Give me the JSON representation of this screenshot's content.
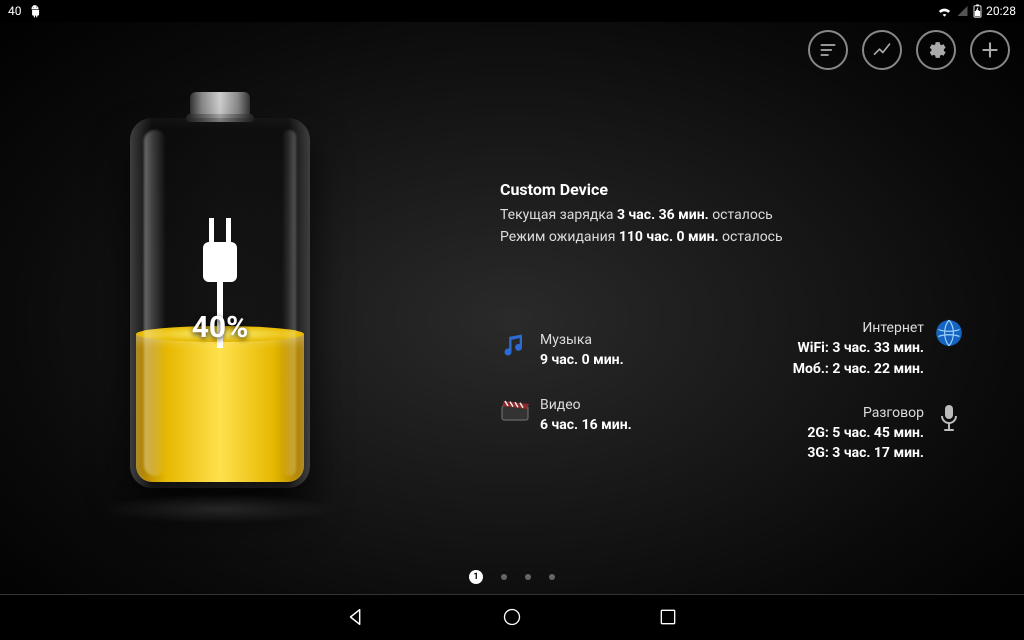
{
  "status": {
    "left_value": "40",
    "time": "20:28"
  },
  "battery": {
    "percent_label": "40%",
    "fill_percent": 40
  },
  "info": {
    "device": "Custom Device",
    "charge_prefix": "Текущая зарядка ",
    "charge_value": "3 час. 36 мин.",
    "charge_suffix": " осталось",
    "standby_prefix": "Режим ожидания ",
    "standby_value": "110 час. 0 мин.",
    "standby_suffix": " осталось"
  },
  "usage": {
    "music": {
      "title": "Музыка",
      "value": "9 час. 0 мин."
    },
    "video": {
      "title": "Видео",
      "value": "6 час. 16 мин."
    },
    "internet": {
      "title": "Интернет",
      "wifi": "WiFi: 3 час. 33 мин.",
      "mob": "Моб.: 2 час. 22 мин."
    },
    "talk": {
      "title": "Разговор",
      "g2": "2G: 5 час. 45 мин.",
      "g3": "3G: 3 час. 17 мин."
    }
  },
  "pager": {
    "active_label": "1"
  }
}
